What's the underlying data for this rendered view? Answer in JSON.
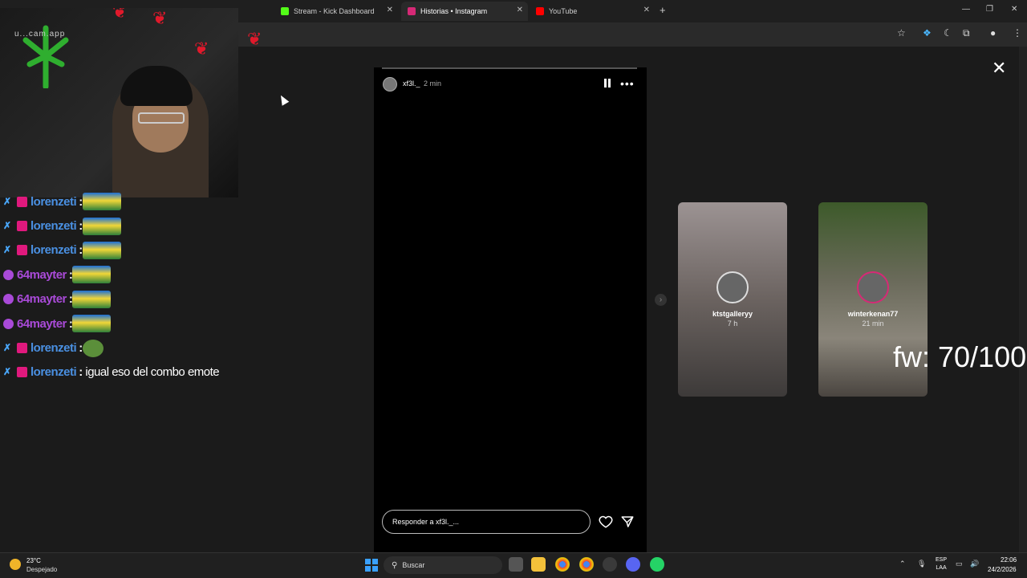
{
  "browser": {
    "tabs": [
      {
        "label": "Stream - Kick Dashboard",
        "favicon_color": "#53fc18",
        "active": false
      },
      {
        "label": "Historias • Instagram",
        "favicon_color": "#d62976",
        "active": true
      },
      {
        "label": "YouTube",
        "favicon_color": "#ff0000",
        "active": false
      }
    ]
  },
  "stream_overlay": {
    "cam_url": "u...cam.app",
    "chat": [
      {
        "user": "lorenzeti",
        "badge": "mod",
        "color": "#4a90e2",
        "emote": "car"
      },
      {
        "user": "lorenzeti",
        "badge": "mod",
        "color": "#4a90e2",
        "emote": "car"
      },
      {
        "user": "lorenzeti",
        "badge": "mod",
        "color": "#4a90e2",
        "emote": "car"
      },
      {
        "user": "64mayter",
        "badge": "mic",
        "color": "#a94ad8",
        "emote": "car"
      },
      {
        "user": "64mayter",
        "badge": "mic",
        "color": "#a94ad8",
        "emote": "car"
      },
      {
        "user": "64mayter",
        "badge": "mic",
        "color": "#a94ad8",
        "emote": "car"
      },
      {
        "user": "lorenzeti",
        "badge": "mod",
        "color": "#4a90e2",
        "emote": "pepe"
      },
      {
        "user": "lorenzeti",
        "badge": "mod",
        "color": "#4a90e2",
        "text": "igual eso del combo emote"
      }
    ],
    "follow_goal": "fw: 70/100"
  },
  "story": {
    "username": "xf3l._",
    "time": "2 min",
    "reply_placeholder": "Responder a xf3l._..."
  },
  "side_stories": [
    {
      "username": "ktstgalleryy",
      "time": "7 h"
    },
    {
      "username": "winterkenan77",
      "time": "21 min"
    }
  ],
  "taskbar": {
    "temp": "23°C",
    "weather": "Despejado",
    "search": "Buscar",
    "lang_top": "ESP",
    "lang_bottom": "LAA",
    "time": "22:06",
    "date": "24/2/2026"
  }
}
